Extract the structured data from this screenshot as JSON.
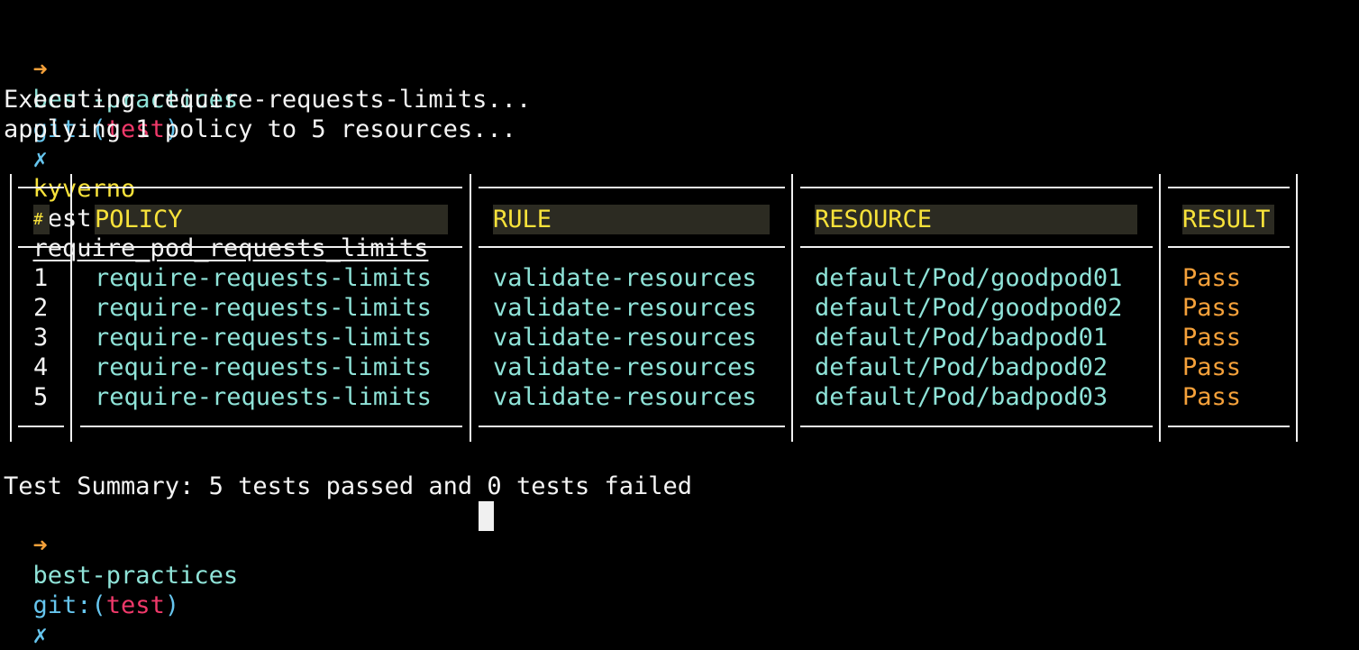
{
  "prompt": {
    "arrow": "➜",
    "dir": "best-practices",
    "git_open": "git:(",
    "branch": "test",
    "git_close": ")",
    "dirty": "✗"
  },
  "command": {
    "name": "kyverno",
    "sub": "test",
    "arg": "require_pod_requests_limits"
  },
  "output": {
    "line1": "Executing require-requests-limits...",
    "line2": "applying 1 policy to 5 resources..."
  },
  "table": {
    "headers": [
      "#",
      "POLICY",
      "RULE",
      "RESOURCE",
      "RESULT"
    ],
    "rows": [
      [
        "1",
        "require-requests-limits",
        "validate-resources",
        "default/Pod/goodpod01",
        "Pass"
      ],
      [
        "2",
        "require-requests-limits",
        "validate-resources",
        "default/Pod/goodpod02",
        "Pass"
      ],
      [
        "3",
        "require-requests-limits",
        "validate-resources",
        "default/Pod/badpod01",
        "Pass"
      ],
      [
        "4",
        "require-requests-limits",
        "validate-resources",
        "default/Pod/badpod02",
        "Pass"
      ],
      [
        "5",
        "require-requests-limits",
        "validate-resources",
        "default/Pod/badpod03",
        "Pass"
      ]
    ]
  },
  "summary": "Test Summary: 5 tests passed and 0 tests failed",
  "colors": {
    "background": "#000000",
    "arrow": "#f5a13a",
    "dir": "#8fe3d8",
    "git": "#66c5ee",
    "branch": "#f0396a",
    "command": "#f7e23a",
    "header": "#f7e23a",
    "result": "#f5a13a"
  }
}
